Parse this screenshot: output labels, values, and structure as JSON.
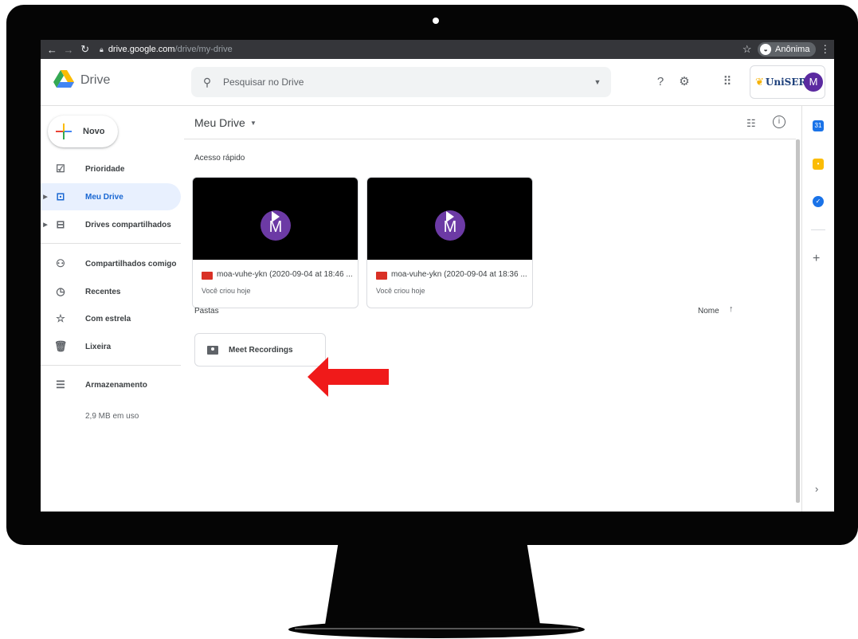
{
  "browser": {
    "url_host": "drive.google.com",
    "url_path": "/drive/my-drive",
    "incognito_label": "Anônima",
    "icons": [
      "back-arrow",
      "forward-arrow",
      "reload",
      "lock",
      "star",
      "incognito",
      "kebab-menu"
    ]
  },
  "header": {
    "app_name": "Drive",
    "search_placeholder": "Pesquisar no Drive",
    "org_logo_text": "UniSER",
    "avatar_letter": "M"
  },
  "sidebar": {
    "new_label": "Novo",
    "items": [
      {
        "label": "Prioridade",
        "icon": "priority-icon"
      },
      {
        "label": "Meu Drive",
        "icon": "my-drive-icon",
        "active": true
      },
      {
        "label": "Drives compartilhados",
        "icon": "shared-drives-icon"
      },
      {
        "label": "Compartilhados comigo",
        "icon": "shared-with-me-icon"
      },
      {
        "label": "Recentes",
        "icon": "clock-icon"
      },
      {
        "label": "Com estrela",
        "icon": "star-icon"
      },
      {
        "label": "Lixeira",
        "icon": "trash-icon"
      },
      {
        "label": "Armazenamento",
        "icon": "storage-icon"
      }
    ],
    "storage_used": "2,9 MB em uso"
  },
  "main": {
    "title": "Meu Drive",
    "quick_access_label": "Acesso rápido",
    "quick_access": [
      {
        "name": "moa-vuhe-ykn (2020-09-04 at 18:46 ...",
        "subtitle": "Você criou hoje",
        "thumb_letter": "M"
      },
      {
        "name": "moa-vuhe-ykn (2020-09-04 at 18:36 ...",
        "subtitle": "Você criou hoje",
        "thumb_letter": "M"
      }
    ],
    "folders_label": "Pastas",
    "sort_label": "Nome",
    "folders": [
      {
        "name": "Meet Recordings"
      }
    ]
  },
  "colors": {
    "accent_blue": "#1967d2",
    "active_bg": "#e8f0fe",
    "video_icon_red": "#d93025",
    "annotation_arrow": "#f01a1a",
    "avatar_purple": "#5b2aa0"
  }
}
